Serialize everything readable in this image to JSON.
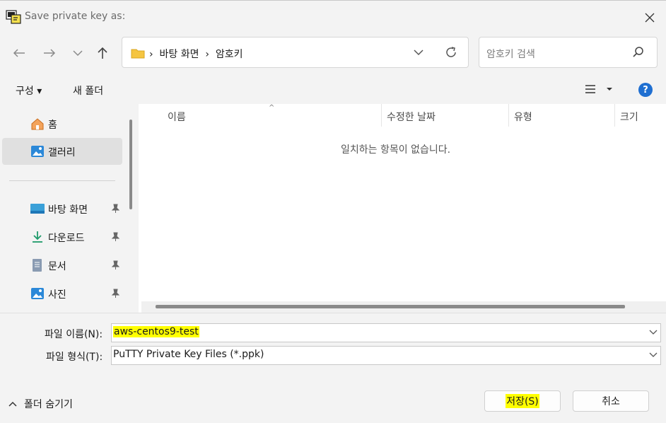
{
  "window": {
    "title": "Save private key as:"
  },
  "address": {
    "path": "›  바탕 화면  ›  암호키"
  },
  "search": {
    "placeholder": "암호키 검색"
  },
  "toolbar": {
    "organize_label": "구성 ▾",
    "new_folder_label": "새 폴더",
    "help_label": "?"
  },
  "sidebar": {
    "items": [
      {
        "label": "홈",
        "icon": "home-icon"
      },
      {
        "label": "갤러리",
        "icon": "gallery-icon",
        "selected": true
      },
      {
        "label": "바탕 화면",
        "icon": "desktop-icon",
        "pinned": true
      },
      {
        "label": "다운로드",
        "icon": "download-icon",
        "pinned": true
      },
      {
        "label": "문서",
        "icon": "document-icon",
        "pinned": true
      },
      {
        "label": "사진",
        "icon": "pictures-icon",
        "pinned": true
      }
    ]
  },
  "filelist": {
    "columns": [
      "이름",
      "수정한 날짜",
      "유형",
      "크기"
    ],
    "empty_message": "일치하는 항목이 없습니다."
  },
  "form": {
    "filename_label": "파일 이름(N):",
    "filename_value": "aws-centos9-test",
    "filetype_label": "파일 형식(T):",
    "filetype_value": "PuTTY Private Key Files (*.ppk)"
  },
  "buttons": {
    "hide_folders": "폴더 숨기기",
    "save": "저장(S)",
    "cancel": "취소"
  },
  "colors": {
    "accent": "#1f6fd1",
    "highlight": "#ffff00",
    "selected_bg": "#e0e0e0"
  }
}
